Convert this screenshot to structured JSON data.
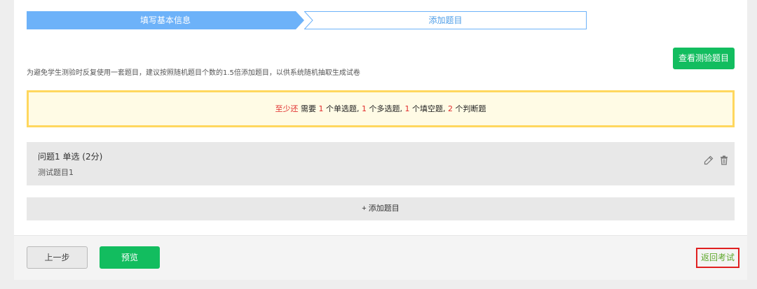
{
  "steps": [
    {
      "label": "填写基本信息",
      "state": "done"
    },
    {
      "label": "添加题目",
      "state": "current"
    }
  ],
  "view_button_label": "查看测验题目",
  "hint_text": "为避免学生测验时反复使用一套题目，建议按照随机题目个数的1.5倍添加题目，以供系统随机抽取生成试卷",
  "requirement": {
    "prefix": "至少还",
    "need": "需要",
    "single_count": "1",
    "single_label": "个单选题,",
    "multi_count": "1",
    "multi_label": "个多选题,",
    "fill_count": "1",
    "fill_label": "个填空题,",
    "judge_count": "2",
    "judge_label": "个判断题"
  },
  "question": {
    "title": "问题1  单选 (2分)",
    "body": "测试题目1",
    "icons": [
      "pencil-icon",
      "trash-icon"
    ]
  },
  "add_question_label": "+ 添加题目",
  "footer": {
    "prev_label": "上一步",
    "preview_label": "预览",
    "back_label": "返回考试"
  },
  "colors": {
    "accent_blue": "#6db2f9",
    "green": "#12bd5f",
    "warn_border": "#ffd75e",
    "red": "#e02b2b"
  }
}
